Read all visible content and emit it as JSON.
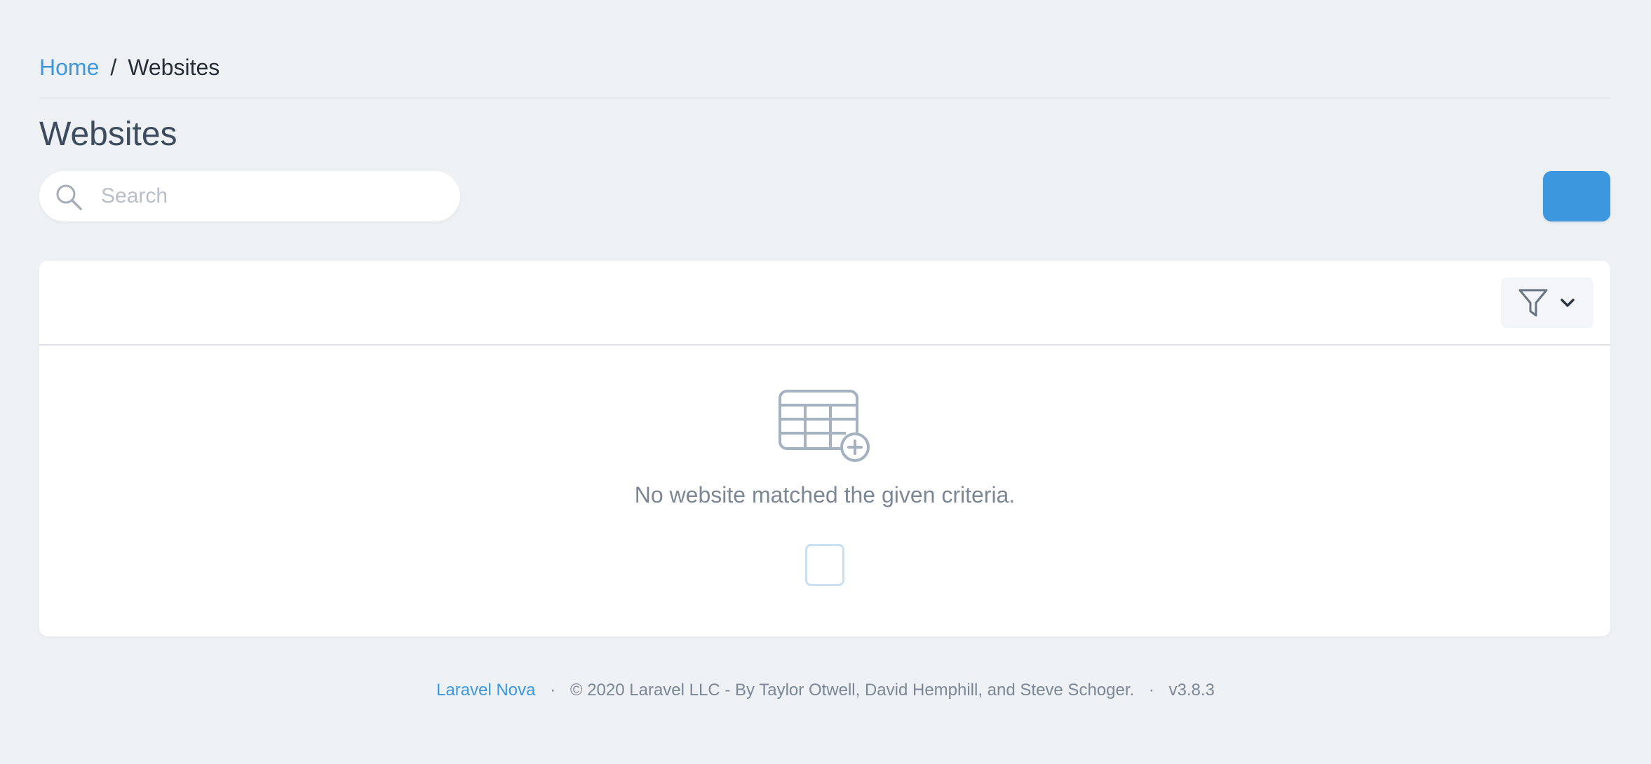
{
  "breadcrumb": {
    "home_label": "Home",
    "separator": "/",
    "current_label": "Websites"
  },
  "page": {
    "title": "Websites"
  },
  "search": {
    "placeholder": "Search",
    "value": ""
  },
  "colors": {
    "accent": "#3c97de",
    "background": "#eef1f4",
    "card": "#ffffff",
    "muted_text": "#7b8794",
    "icon": "#a5b3c0"
  },
  "icons": {
    "search": "search-icon",
    "filter": "filter-icon",
    "chevron": "chevron-down-icon",
    "empty": "table-add-icon"
  },
  "empty_state": {
    "message": "No website matched the given criteria."
  },
  "footer": {
    "link_label": "Laravel Nova",
    "copyright": "© 2020 Laravel LLC - By Taylor Otwell, David Hemphill, and Steve Schoger.",
    "version": "v3.8.3",
    "separator": "·"
  }
}
